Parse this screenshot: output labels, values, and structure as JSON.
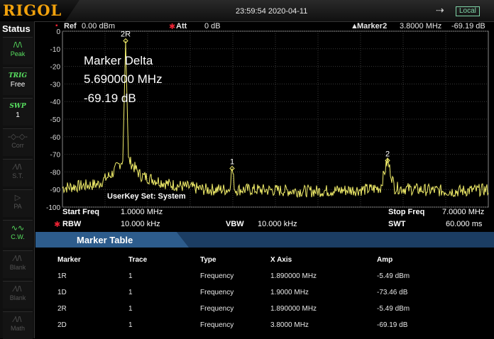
{
  "topbar": {
    "brand": "RIGOL",
    "datetime": "23:59:54  2020-04-11",
    "usb_symbol": "⇢",
    "mode": "Local"
  },
  "sidebar": {
    "title": "Status",
    "buttons": [
      {
        "label": "Peak",
        "icon": "peak-icon"
      },
      {
        "label": "Free",
        "icon": "trig-icon",
        "tag": "TRIG"
      },
      {
        "label": "1",
        "icon": "swp-icon",
        "tag": "SWP"
      },
      {
        "label": "Corr",
        "icon": "corr-icon"
      },
      {
        "label": "S.T.",
        "icon": "st-icon"
      },
      {
        "label": "PA",
        "icon": "pa-icon"
      },
      {
        "label": "C.W.",
        "icon": "cw-icon"
      },
      {
        "label": "Blank",
        "icon": "blank-icon"
      },
      {
        "label": "Blank",
        "icon": "blank-icon"
      },
      {
        "label": "Math",
        "icon": "math-icon"
      }
    ]
  },
  "header": {
    "ref_label": "Ref",
    "ref_value": "0.00 dBm",
    "att_label": "Att",
    "att_value": "0 dB",
    "marker_label": "Marker2",
    "marker_freq": "3.8000 MHz",
    "marker_amp": "-69.19 dB"
  },
  "plot": {
    "y_ticks": [
      "0",
      "-10",
      "-20",
      "-30",
      "-40",
      "-50",
      "-60",
      "-70",
      "-80",
      "-90",
      "-100"
    ],
    "marker_labels": [
      "2R",
      "1",
      "2"
    ],
    "delta_title": "Marker Delta",
    "delta_freq": "5.690000 MHz",
    "delta_amp": "-69.19 dB",
    "userkey_text": "UserKey Set:   System",
    "colors": {
      "trace": "#f2ee6a",
      "grid": "#3a3a3a",
      "ref_marker": "#f2ee6a"
    }
  },
  "chart_data": {
    "type": "line",
    "ylim": [
      -100,
      0
    ],
    "xlim_mhz": [
      1.0,
      7.0
    ],
    "y_ticks": [
      0,
      -10,
      -20,
      -30,
      -40,
      -50,
      -60,
      -70,
      -80,
      -90,
      -100
    ],
    "series": [
      {
        "x": [
          1.0,
          1.5,
          1.7,
          1.85,
          1.89,
          1.93,
          2.1,
          2.5,
          3.0,
          3.35,
          3.39,
          3.43,
          3.6,
          4.5,
          5.3,
          5.48,
          5.58,
          5.68,
          6.0,
          6.5,
          7.0
        ],
        "y": [
          -89,
          -87,
          -81,
          -73,
          -5.5,
          -73,
          -82,
          -87,
          -90,
          -90,
          -78,
          -90,
          -90,
          -91,
          -90,
          -89,
          -73.5,
          -89,
          -90,
          -91,
          -90
        ]
      }
    ],
    "markers": [
      {
        "name": "2R",
        "x": 1.89,
        "y": -5.49
      },
      {
        "name": "1",
        "x": 3.39,
        "y": -78
      },
      {
        "name": "2",
        "x": 5.58,
        "y": -73.5
      }
    ]
  },
  "footer": {
    "start_label": "Start Freq",
    "start_value": "1.0000 MHz",
    "stop_label": "Stop Freq",
    "stop_value": "7.0000 MHz",
    "rbw_label": "RBW",
    "rbw_value": "10.000 kHz",
    "vbw_label": "VBW",
    "vbw_value": "10.000 kHz",
    "swt_label": "SWT",
    "swt_value": "60.000 ms"
  },
  "marker_table": {
    "title": "Marker Table",
    "columns": [
      "Marker",
      "Trace",
      "Type",
      "X Axis",
      "Amp"
    ],
    "rows": [
      [
        "1R",
        "1",
        "Frequency",
        "1.890000 MHz",
        "-5.49 dBm"
      ],
      [
        "1D",
        "1",
        "Frequency",
        "1.9000 MHz",
        "-73.46 dB"
      ],
      [
        "2R",
        "1",
        "Frequency",
        "1.890000 MHz",
        "-5.49 dBm"
      ],
      [
        "2D",
        "1",
        "Frequency",
        "3.8000 MHz",
        "-69.19 dB"
      ]
    ]
  }
}
